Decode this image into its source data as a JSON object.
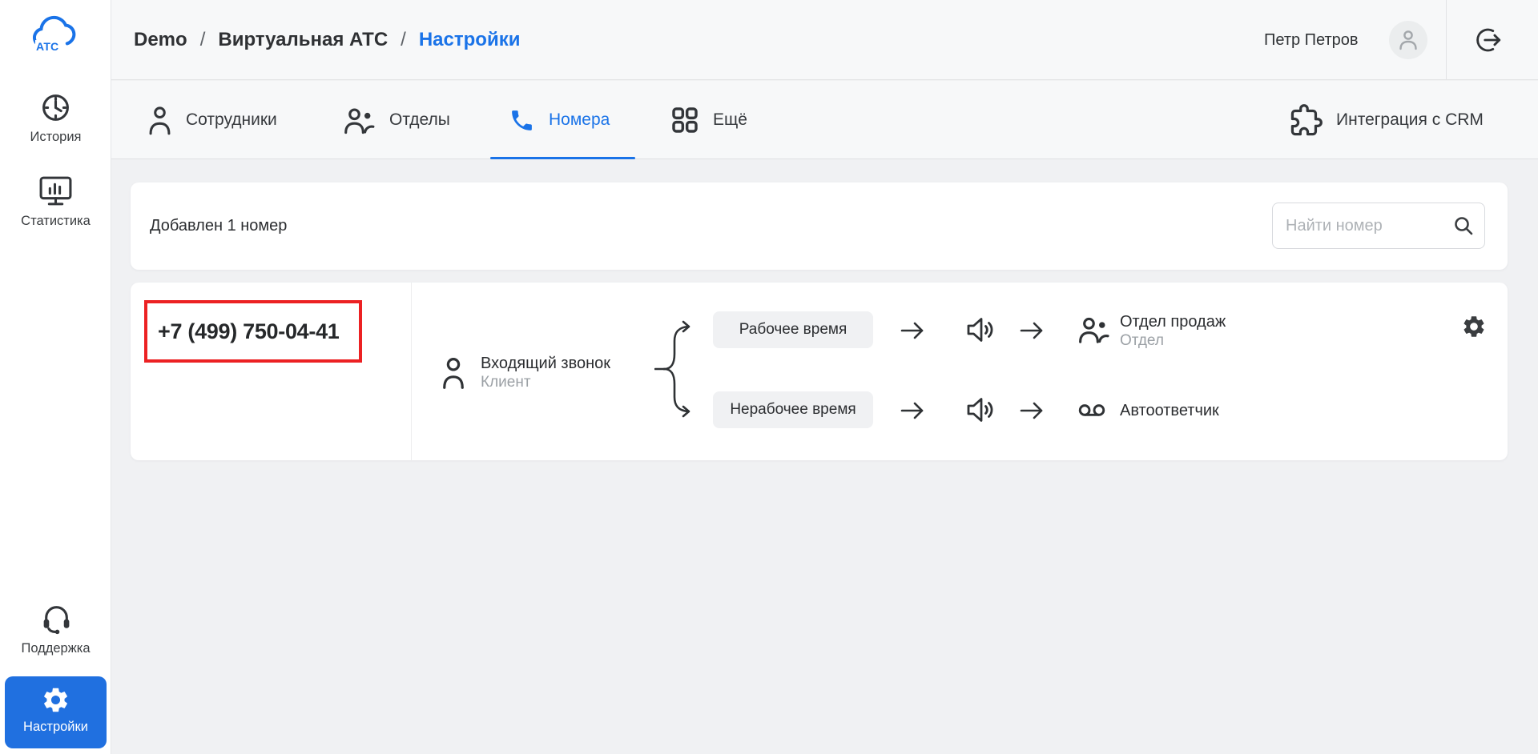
{
  "app": {
    "logo_text": "АТС"
  },
  "sidebar": {
    "items": [
      {
        "label": "История",
        "icon": "history-clock-icon"
      },
      {
        "label": "Статистика",
        "icon": "statistics-monitor-icon"
      }
    ],
    "bottom_items": [
      {
        "label": "Поддержка",
        "icon": "support-headset-icon"
      },
      {
        "label": "Настройки",
        "icon": "settings-gear-icon",
        "active": true
      }
    ]
  },
  "header": {
    "breadcrumb": [
      {
        "label": "Demo"
      },
      {
        "label": "Виртуальная АТС"
      },
      {
        "label": "Настройки"
      }
    ],
    "separator": "/",
    "user_name": "Петр Петров"
  },
  "tabs": {
    "items": [
      {
        "label": "Сотрудники",
        "icon": "person-icon"
      },
      {
        "label": "Отделы",
        "icon": "people-icon"
      },
      {
        "label": "Номера",
        "icon": "phone-icon",
        "active": true
      },
      {
        "label": "Ещё",
        "icon": "grid-icon"
      }
    ],
    "crm_label": "Интеграция с CRM"
  },
  "numbers_panel": {
    "summary": "Добавлен 1 номер",
    "search_placeholder": "Найти номер"
  },
  "number_card": {
    "phone": "+7 (499) 750-04-41",
    "source": {
      "title": "Входящий звонок",
      "subtitle": "Клиент"
    },
    "branches": [
      {
        "condition": "Рабочее время",
        "target_title": "Отдел продаж",
        "target_subtitle": "Отдел",
        "target_icon": "people-icon"
      },
      {
        "condition": "Нерабочее время",
        "target_title": "Автоответчик",
        "target_icon": "voicemail-icon"
      }
    ]
  },
  "colors": {
    "accent": "#1a73e8",
    "sidebar_active_bg": "#2070e0",
    "annotation_red": "#ec2123"
  }
}
